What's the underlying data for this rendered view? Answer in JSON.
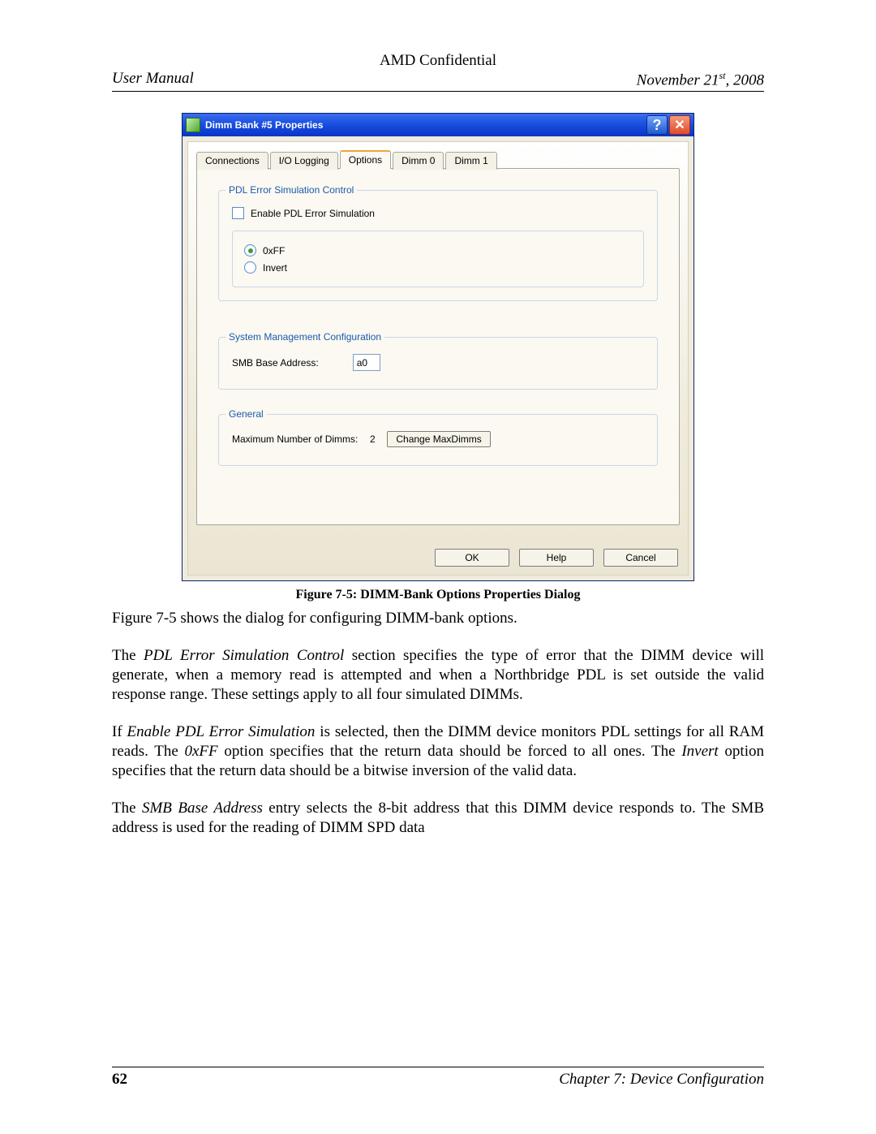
{
  "header": {
    "classification": "AMD Confidential",
    "left": "User Manual",
    "date_prefix": "November 21",
    "date_ordinal": "st",
    "date_suffix": ", 2008"
  },
  "footer": {
    "page": "62",
    "chapter": "Chapter 7: Device Configuration"
  },
  "dialog": {
    "title": "Dimm Bank #5 Properties",
    "tabs": [
      "Connections",
      "I/O Logging",
      "Options",
      "Dimm 0",
      "Dimm 1"
    ],
    "active_tab": 2,
    "group1": {
      "title": "PDL Error Simulation Control",
      "checkbox": "Enable PDL Error Simulation",
      "radio_0xff": "0xFF",
      "radio_invert": "Invert",
      "selected_radio": 0
    },
    "group2": {
      "title": "System Management Configuration",
      "label": "SMB Base Address:",
      "value": "a0"
    },
    "group3": {
      "title": "General",
      "label": "Maximum Number of Dimms:",
      "value": "2",
      "button": "Change MaxDimms"
    },
    "buttons": {
      "ok": "OK",
      "help": "Help",
      "cancel": "Cancel"
    }
  },
  "caption": "Figure 7-5: DIMM-Bank Options Properties Dialog",
  "body": {
    "p1": "Figure 7-5 shows the dialog for configuring DIMM-bank options.",
    "p2a": "The ",
    "p2i": "PDL Error Simulation Control",
    "p2b": " section specifies the type of error that the DIMM device will generate, when a memory read is attempted and when a Northbridge PDL is set outside the valid response range. These settings apply to all four simulated DIMMs.",
    "p3a": "If ",
    "p3i1": "Enable PDL Error Simulation",
    "p3b": " is selected, then the DIMM device monitors PDL settings for all RAM reads. The ",
    "p3i2": "0xFF",
    "p3c": " option specifies that the return data should be forced to all ones. The ",
    "p3i3": "Invert",
    "p3d": " option specifies that the return data should be a bitwise inversion of the valid data.",
    "p4a": "The ",
    "p4i": "SMB Base Address",
    "p4b": " entry selects the 8-bit address that this DIMM device responds to. The SMB address is used for the reading of DIMM SPD data"
  }
}
